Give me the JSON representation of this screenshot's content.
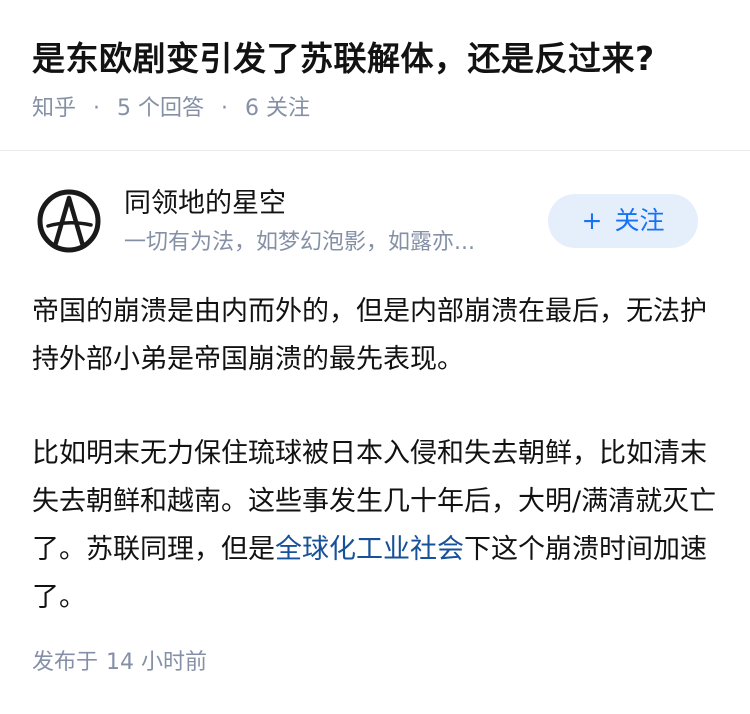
{
  "question": {
    "title": "是东欧剧变引发了苏联解体，还是反过来?",
    "source": "知乎",
    "separator": "·",
    "answer_count": "5 个回答",
    "follower_count": "6 关注"
  },
  "author": {
    "avatar_icon": "anarchy-circle-a-icon",
    "name": "同领地的星空",
    "bio": "一切有为法，如梦幻泡影，如露亦...",
    "follow_label": "关注",
    "follow_icon": "plus-icon"
  },
  "answer": {
    "paragraph1": "帝国的崩溃是由内而外的，但是内部崩溃在最后，无法护持外部小弟是帝国崩溃的最先表现。",
    "paragraph2_before_link": "比如明末无力保住琉球被日本入侵和失去朝鲜，比如清末失去朝鲜和越南。这些事发生几十年后，大明/满清就灭亡了。苏联同理，但是",
    "paragraph2_link": "全球化工业社会",
    "paragraph2_after_link": "下这个崩溃时间加速了。"
  },
  "footer": {
    "published_label": "发布于",
    "published_time": "14 小时前"
  },
  "colors": {
    "text": "#121212",
    "muted": "#8590a6",
    "link": "#175199",
    "follow_bg": "#e5effc",
    "follow_text": "#1772f6"
  }
}
